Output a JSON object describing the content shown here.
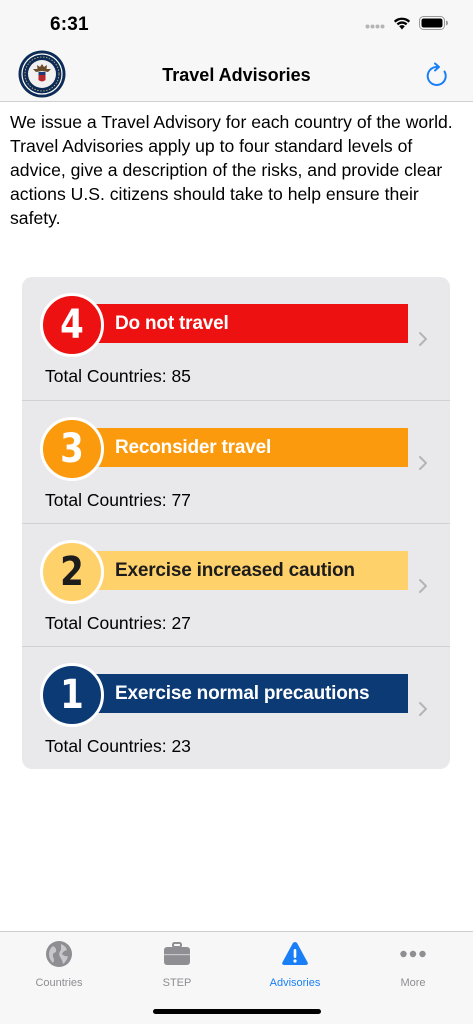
{
  "status": {
    "time": "6:31"
  },
  "nav": {
    "title": "Travel Advisories"
  },
  "intro": "We issue a Travel Advisory for each country of the world. Travel Advisories apply up to four standard levels of advice, give a description of the risks, and provide clear actions U.S. citizens should take to help ensure their safety.",
  "levels": [
    {
      "number": "4",
      "label": "Do not travel",
      "total": "Total Countries: 85",
      "color": "#ee1111",
      "circle_color": "#ee1111",
      "text_color": "#ffffff",
      "number_color": "#ffffff"
    },
    {
      "number": "3",
      "label": "Reconsider travel",
      "total": "Total Countries: 77",
      "color": "#fb9a0c",
      "circle_color": "#fb9a0c",
      "text_color": "#ffffff",
      "number_color": "#ffffff"
    },
    {
      "number": "2",
      "label": "Exercise increased caution",
      "total": "Total Countries: 27",
      "color": "#ffd16b",
      "circle_color": "#ffd16b",
      "text_color": "#1c1c1c",
      "number_color": "#1c1c1c"
    },
    {
      "number": "1",
      "label": "Exercise normal precautions",
      "total": "Total Countries: 23",
      "color": "#0b3a75",
      "circle_color": "#0b3a75",
      "text_color": "#ffffff",
      "number_color": "#ffffff"
    }
  ],
  "tabs": [
    {
      "label": "Countries",
      "icon": "globe-icon"
    },
    {
      "label": "STEP",
      "icon": "briefcase-icon"
    },
    {
      "label": "Advisories",
      "icon": "warning-icon"
    },
    {
      "label": "More",
      "icon": "more-icon"
    }
  ],
  "colors": {
    "accent": "#1a7ff6",
    "inactive": "#8e8e93"
  }
}
